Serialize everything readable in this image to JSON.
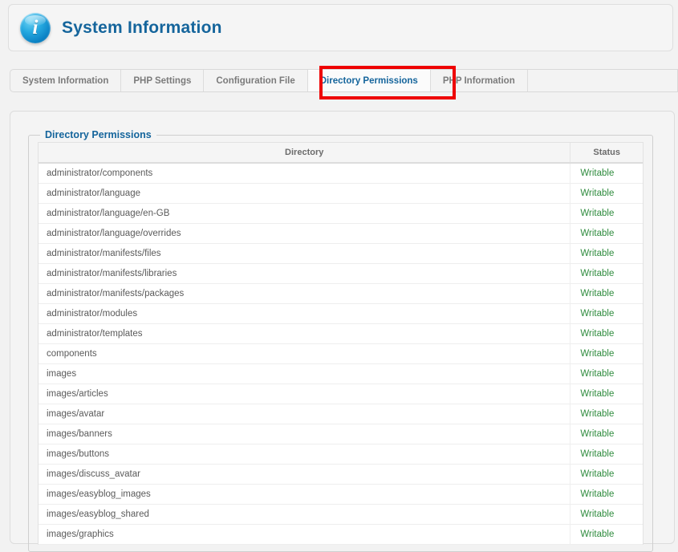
{
  "header": {
    "icon": "info-circle-icon",
    "title": "System Information"
  },
  "tabs": [
    {
      "label": "System Information",
      "active": false
    },
    {
      "label": "PHP Settings",
      "active": false
    },
    {
      "label": "Configuration File",
      "active": false
    },
    {
      "label": "Directory Permissions",
      "active": true
    },
    {
      "label": "PHP Information",
      "active": false
    }
  ],
  "annotation": {
    "type": "highlight-rectangle",
    "color": "#ee0000",
    "target": "Directory Permissions"
  },
  "panel": {
    "legend": "Directory Permissions",
    "columns": [
      "Directory",
      "Status"
    ],
    "status_color": "#2e8b3d",
    "rows": [
      {
        "directory": "administrator/components",
        "status": "Writable"
      },
      {
        "directory": "administrator/language",
        "status": "Writable"
      },
      {
        "directory": "administrator/language/en-GB",
        "status": "Writable"
      },
      {
        "directory": "administrator/language/overrides",
        "status": "Writable"
      },
      {
        "directory": "administrator/manifests/files",
        "status": "Writable"
      },
      {
        "directory": "administrator/manifests/libraries",
        "status": "Writable"
      },
      {
        "directory": "administrator/manifests/packages",
        "status": "Writable"
      },
      {
        "directory": "administrator/modules",
        "status": "Writable"
      },
      {
        "directory": "administrator/templates",
        "status": "Writable"
      },
      {
        "directory": "components",
        "status": "Writable"
      },
      {
        "directory": "images",
        "status": "Writable"
      },
      {
        "directory": "images/articles",
        "status": "Writable"
      },
      {
        "directory": "images/avatar",
        "status": "Writable"
      },
      {
        "directory": "images/banners",
        "status": "Writable"
      },
      {
        "directory": "images/buttons",
        "status": "Writable"
      },
      {
        "directory": "images/discuss_avatar",
        "status": "Writable"
      },
      {
        "directory": "images/easyblog_images",
        "status": "Writable"
      },
      {
        "directory": "images/easyblog_shared",
        "status": "Writable"
      },
      {
        "directory": "images/graphics",
        "status": "Writable"
      }
    ]
  }
}
